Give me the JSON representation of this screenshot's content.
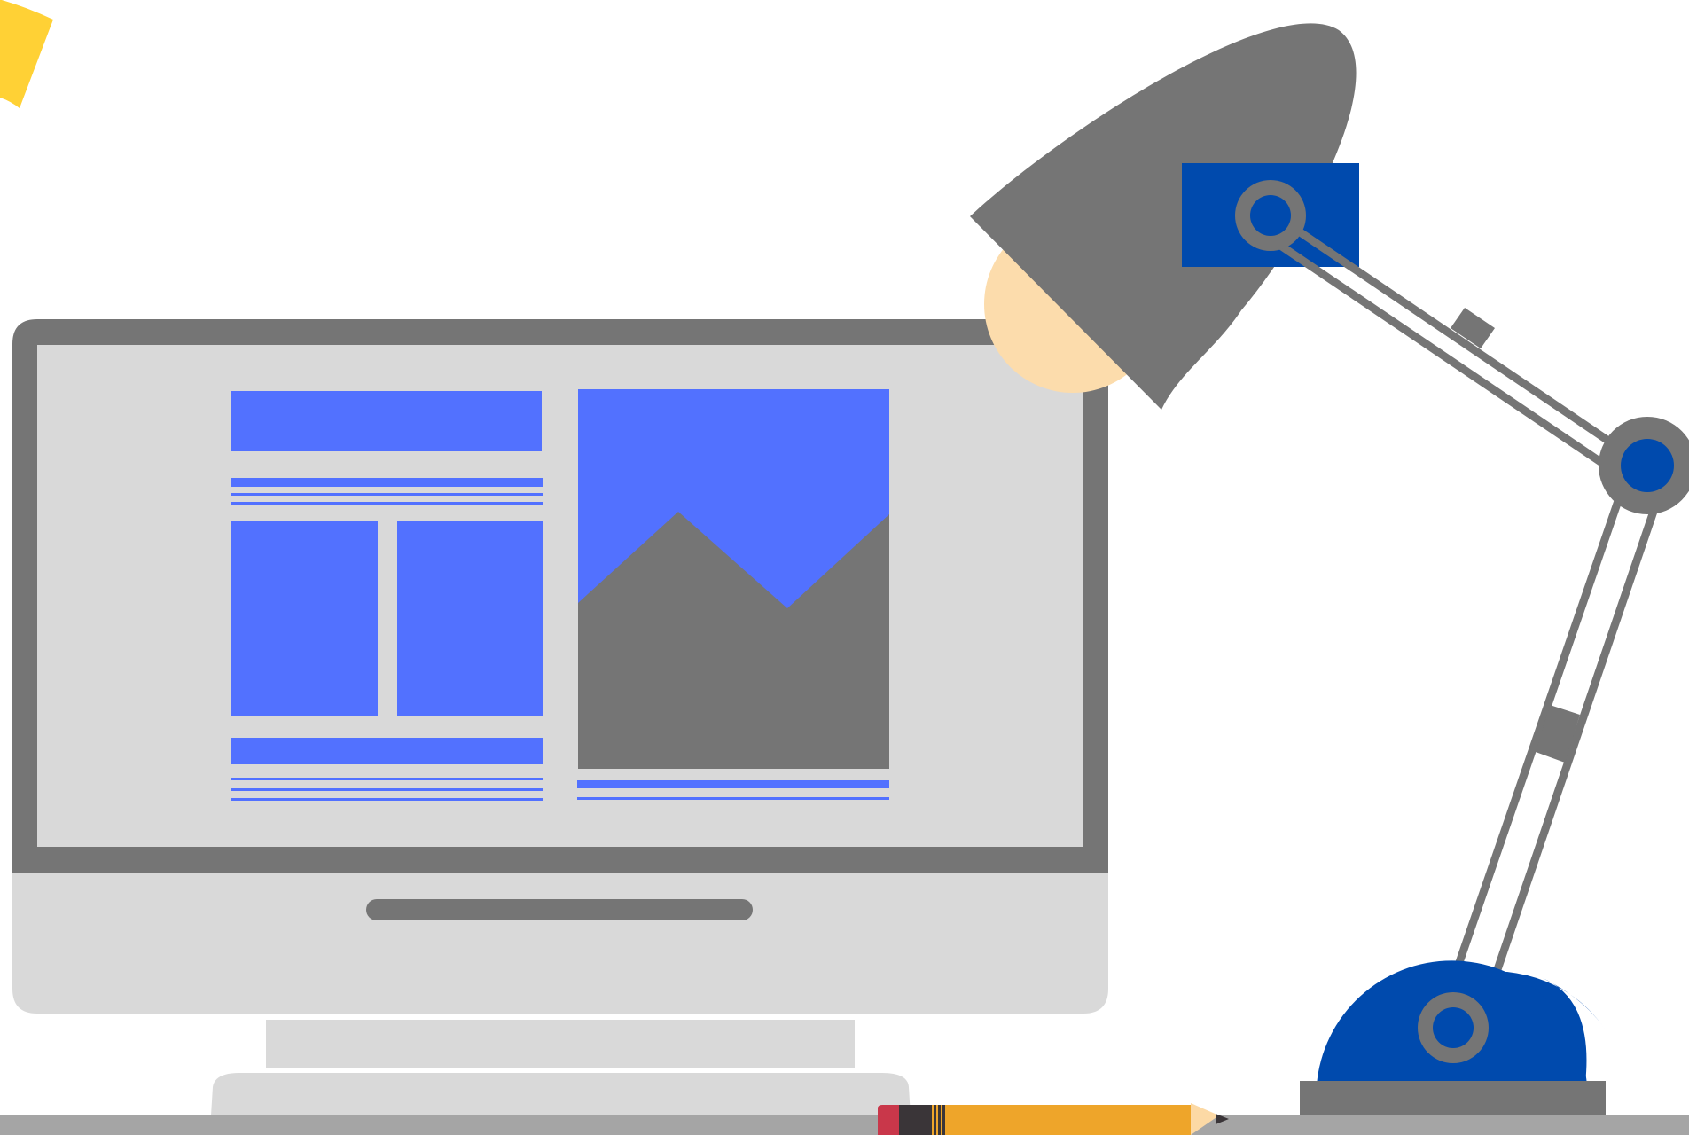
{
  "scene": {
    "description_icons": [
      "yellow-sticky-note-icon",
      "monitor-icon",
      "desk-lamp-icon",
      "pencil-icon"
    ]
  },
  "colors": {
    "background": "#ffffff",
    "desk": "#a5a5a5",
    "monitor_bezel": "#757575",
    "monitor_screen": "#d9d9d9",
    "ui_blue": "#5271ff",
    "lamp_gray": "#757575",
    "lamp_blue": "#004aad",
    "lamp_light": "#fcdcac",
    "sticky_yellow": "#ffd135",
    "pencil_body": "#eea52a",
    "pencil_eraser": "#c9374a",
    "pencil_ferrule": "#3a3538",
    "pencil_wood": "#fcd9a5"
  }
}
